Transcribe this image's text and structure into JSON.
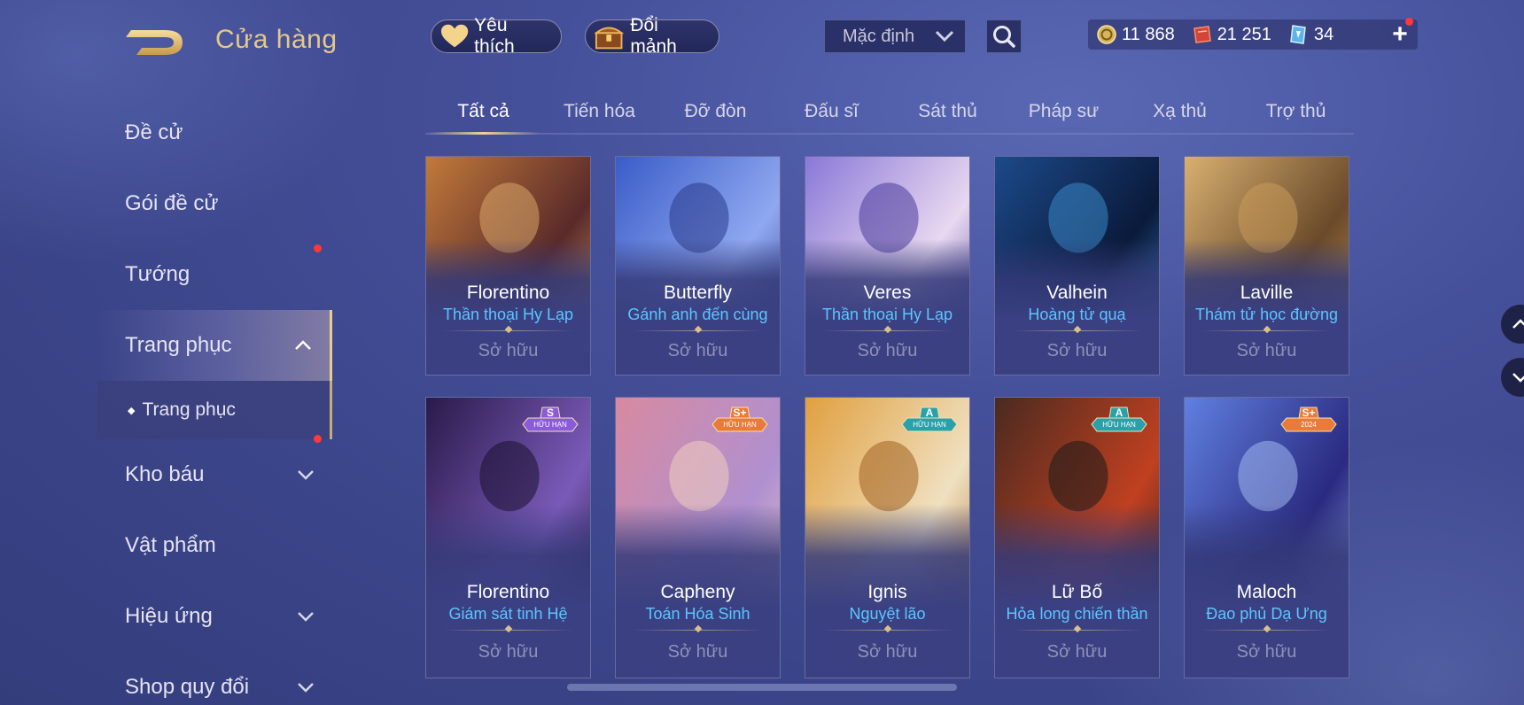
{
  "header": {
    "title": "Cửa hàng",
    "favorites_label": "Yêu thích",
    "shard_exchange_label": "Đổi mảnh",
    "sort_value": "Mặc định",
    "gold": "11 868",
    "vouchers": "21 251",
    "gems": "34",
    "add_label": "+"
  },
  "sidebar": {
    "items": [
      {
        "label": "Đề cử"
      },
      {
        "label": "Gói đề cử"
      },
      {
        "label": "Tướng"
      },
      {
        "label": "Trang phục"
      },
      {
        "label": "Kho báu"
      },
      {
        "label": "Vật phẩm"
      },
      {
        "label": "Hiệu ứng"
      },
      {
        "label": "Shop quy đổi"
      }
    ],
    "subitem": "Trang phục"
  },
  "tabs": [
    "Tất cả",
    "Tiến hóa",
    "Đỡ đòn",
    "Đấu sĩ",
    "Sát thủ",
    "Pháp sư",
    "Xạ thủ",
    "Trợ thủ"
  ],
  "cards": [
    {
      "name": "Florentino",
      "skin": "Thần thoại Hy Lạp",
      "status": "Sở hữu"
    },
    {
      "name": "Butterfly",
      "skin": "Gánh anh đến cùng",
      "status": "Sở hữu"
    },
    {
      "name": "Veres",
      "skin": "Thần thoại Hy Lạp",
      "status": "Sở hữu"
    },
    {
      "name": "Valhein",
      "skin": "Hoàng tử quạ",
      "status": "Sở hữu"
    },
    {
      "name": "Laville",
      "skin": "Thám tử học đường",
      "status": "Sở hữu"
    },
    {
      "name": "Florentino",
      "skin": "Giám sát tinh Hệ",
      "status": "Sở hữu",
      "grade": "S",
      "limited": "HỮU HẠN"
    },
    {
      "name": "Capheny",
      "skin": "Toán Hóa Sinh",
      "status": "Sở hữu",
      "grade": "S+",
      "limited": "HỮU HẠN"
    },
    {
      "name": "Ignis",
      "skin": "Nguyệt lão",
      "status": "Sở hữu",
      "grade": "A",
      "limited": "HỮU HẠN"
    },
    {
      "name": "Lữ Bố",
      "skin": "Hỏa long chiến thần",
      "status": "Sở hữu",
      "grade": "A",
      "limited": "HỮU HẠN"
    },
    {
      "name": "Maloch",
      "skin": "Đao phủ Dạ Ưng",
      "status": "Sở hữu",
      "grade": "S+",
      "limited": "2024"
    }
  ],
  "colors": {
    "accent_gold": "#e4c88a",
    "skin_name_blue": "#5bc6ff",
    "notification_red": "#ff3838"
  }
}
